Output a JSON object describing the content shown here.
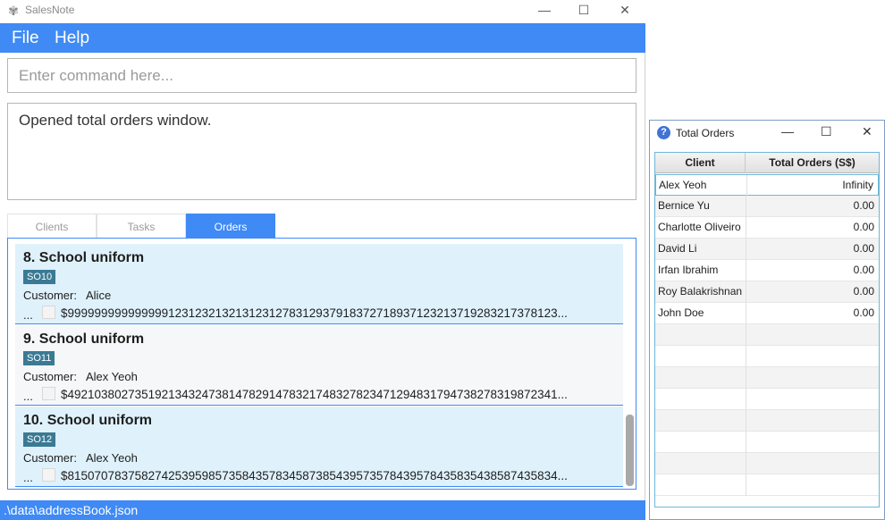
{
  "main_window": {
    "title": "SalesNote",
    "app_icon": "sparkle-icon",
    "controls": {
      "minimize": "—",
      "maximize": "☐",
      "close": "✕"
    },
    "menu": {
      "file": "File",
      "help": "Help"
    },
    "command": {
      "placeholder": "Enter command here...",
      "value": ""
    },
    "result": "Opened total orders window.",
    "tabs": {
      "clients": "Clients",
      "tasks": "Tasks",
      "orders": "Orders"
    },
    "orders": [
      {
        "title": "8. School uniform",
        "tag": "SO10",
        "customer_label": "Customer:",
        "customer": "Alice",
        "ellipsis": "...",
        "amount": "$9999999999999991231232132131231278312937918372718937123213719283217378123..."
      },
      {
        "title": "9. School uniform",
        "tag": "SO11",
        "customer_label": "Customer:",
        "customer": "Alex Yeoh",
        "ellipsis": "...",
        "amount": "$4921038027351921343247381478291478321748327823471294831794738278319872341..."
      },
      {
        "title": "10. School uniform",
        "tag": "SO12",
        "customer_label": "Customer:",
        "customer": "Alex Yeoh",
        "ellipsis": "...",
        "amount": "$8150707837582742539598573584357834587385439573578439578435835438587435834..."
      }
    ],
    "status": ".\\data\\addressBook.json"
  },
  "orders_window": {
    "title": "Total Orders",
    "icon": "question-icon",
    "controls": {
      "minimize": "—",
      "maximize": "☐",
      "close": "✕"
    },
    "columns": {
      "client": "Client",
      "total": "Total Orders (S$)"
    },
    "rows": [
      {
        "client": "Alex Yeoh",
        "total": "Infinity"
      },
      {
        "client": "Bernice Yu",
        "total": "0.00"
      },
      {
        "client": "Charlotte Oliveiro",
        "total": "0.00"
      },
      {
        "client": "David Li",
        "total": "0.00"
      },
      {
        "client": "Irfan Ibrahim",
        "total": "0.00"
      },
      {
        "client": "Roy Balakrishnan",
        "total": "0.00"
      },
      {
        "client": "John Doe",
        "total": "0.00"
      }
    ]
  },
  "colors": {
    "accent": "#3f8af5",
    "card_selected": "#dff1fb",
    "badge": "#3a7a95"
  }
}
